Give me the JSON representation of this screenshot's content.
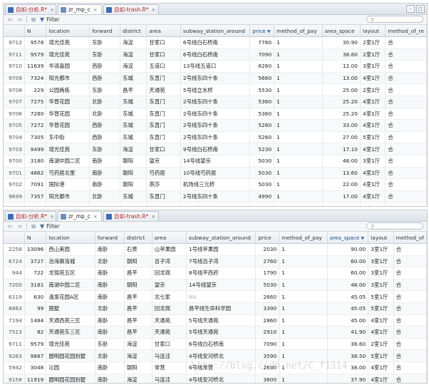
{
  "panels": [
    {
      "tabs": [
        {
          "label": "自如-分析.R*",
          "modified": true
        },
        {
          "label": "zr_mp_c",
          "modified": false
        },
        {
          "label": "自如-trash.R*",
          "modified": true
        }
      ],
      "filter_label": "Filter",
      "columns": [
        "",
        "N",
        "location",
        "forward",
        "district",
        "area",
        "subway_station_around",
        "price",
        "method_of_pay",
        "area_space",
        "layout",
        "method_of_re"
      ],
      "sorted_column": "price",
      "rows": [
        [
          "9712",
          "9578",
          "增光佳苑",
          "东卧",
          "海淀",
          "甘家口",
          "6号线白石桥南",
          "7760",
          "1",
          "30.90",
          "2室1厅",
          "合"
        ],
        [
          "9711",
          "9579",
          "增光佳苑",
          "东卧",
          "海淀",
          "甘家口",
          "6号线白石桥南",
          "7090",
          "1",
          "38.60",
          "2室1厅",
          "合"
        ],
        [
          "9710",
          "11639",
          "华清嘉园",
          "西卧",
          "海淀",
          "五道口",
          "13号线五道口",
          "6260",
          "1",
          "12.00",
          "3室1厅",
          "合"
        ],
        [
          "9709",
          "7324",
          "阳光都市",
          "西卧",
          "东城",
          "东直门",
          "2号线东四十条",
          "5660",
          "1",
          "13.00",
          "4室1厅",
          "合"
        ],
        [
          "9708",
          "229",
          "公园两栋",
          "东卧",
          "昌平",
          "天通苑",
          "5号线立水桥",
          "5530",
          "1",
          "25.00",
          "2室2厅",
          "合"
        ],
        [
          "9707",
          "7275",
          "华普花园",
          "北卧",
          "东城",
          "东直门",
          "2号线东四十条",
          "5360",
          "1",
          "25.20",
          "4室1厅",
          "合"
        ],
        [
          "9706",
          "7280",
          "华普花园",
          "北卧",
          "东城",
          "东直门",
          "2号线东四十条",
          "5360",
          "1",
          "25.20",
          "4室1厅",
          "合"
        ],
        [
          "9705",
          "7272",
          "华普花园",
          "西卧",
          "东城",
          "东直门",
          "2号线东四十条",
          "5260",
          "1",
          "33.00",
          "4室1厅",
          "合"
        ],
        [
          "9704",
          "7305",
          "东中街",
          "西卧",
          "东城",
          "东直门",
          "2号线东四十条",
          "5260",
          "1",
          "27.00",
          "5室1厅",
          "合"
        ],
        [
          "9703",
          "9499",
          "增光佳苑",
          "东卧",
          "海淀",
          "甘家口",
          "9号线白石桥南",
          "5230",
          "1",
          "17.10",
          "4室1厅",
          "合"
        ],
        [
          "9700",
          "3180",
          "南湖中园二区",
          "南卧",
          "朝阳",
          "望京",
          "14号线望京",
          "5030",
          "1",
          "48.00",
          "3室1厅",
          "合"
        ],
        [
          "9701",
          "4662",
          "芍药居北里",
          "南卧",
          "朝阳",
          "芍药居",
          "10号线芍药居",
          "5030",
          "1",
          "13.60",
          "4室2厅",
          "合"
        ],
        [
          "9702",
          "7091",
          "国际港",
          "南卧",
          "朝阳",
          "燕莎",
          "机场线三元桥",
          "5030",
          "1",
          "22.00",
          "4室1厅",
          "合"
        ],
        [
          "9699",
          "7357",
          "阳光都市",
          "北卧",
          "东城",
          "东直门",
          "2号线东四十条",
          "4990",
          "1",
          "17.00",
          "4室1厅",
          "合"
        ],
        [
          "9698",
          "5568",
          "朝庭公寓",
          "东卧",
          "朝阳",
          "望京",
          "14号线望京南",
          "4930",
          "1",
          "13.80",
          "3室1厅",
          "合"
        ]
      ]
    },
    {
      "tabs": [
        {
          "label": "自如-分析.R*",
          "modified": true
        },
        {
          "label": "zr_mp_c",
          "modified": false
        },
        {
          "label": "自如-trash.R*",
          "modified": true
        }
      ],
      "filter_label": "Filter",
      "columns": [
        "",
        "N",
        "location",
        "forward",
        "district",
        "area",
        "subway_station_around",
        "price",
        "method_of_pay",
        "area_space",
        "layout",
        "method_of"
      ],
      "sorted_column": "area_space",
      "rows": [
        [
          "2258",
          "13096",
          "西山美园",
          "南卧",
          "石景",
          "山苹果园",
          "1号线苹果园",
          "2030",
          "1",
          "90.00",
          "3室1厅",
          "合"
        ],
        [
          "6724",
          "3727",
          "治海赛洛城",
          "北卧",
          "朝阳",
          "百子湾",
          "7号线百子湾",
          "2760",
          "1",
          "60.00",
          "3室1厅",
          "合"
        ],
        [
          "944",
          "722",
          "龙锦苑五区",
          "南卧",
          "昌平",
          "回龙观",
          "8号线平西府",
          "1790",
          "1",
          "60.00",
          "3室1厅",
          "合"
        ],
        [
          "7200",
          "3181",
          "南湖中园二区",
          "南卧",
          "朝阳",
          "望京",
          "14号线望京",
          "5030",
          "1",
          "48.00",
          "3室1厅",
          "合"
        ],
        [
          "6119",
          "630",
          "温泉花园A区",
          "南卧",
          "昌平",
          "北七家",
          "NA",
          "2660",
          "1",
          "45.05",
          "5室1厅",
          "合"
        ],
        [
          "8863",
          "99",
          "国墅",
          "北卧",
          "昌平",
          "回龙观",
          "昌平线生命科学园",
          "3390",
          "1",
          "45.05",
          "5室1厅",
          "合"
        ],
        [
          "7194",
          "1484",
          "天通西苑三区",
          "南卧",
          "昌平",
          "天通苑",
          "5号线天通苑",
          "2860",
          "1",
          "45.00",
          "4室1厅",
          "合"
        ],
        [
          "7513",
          "82",
          "天通苑东三区",
          "南卧",
          "昌平",
          "天通苑",
          "5号线天通苑",
          "2910",
          "1",
          "41.90",
          "4室1厅",
          "合"
        ],
        [
          "9711",
          "9579",
          "增光佳苑",
          "东卧",
          "海淀",
          "甘家口",
          "6号线白石桥南",
          "7090",
          "1",
          "38.60",
          "2室1厅",
          "合"
        ],
        [
          "9263",
          "9887",
          "圆明园花园别墅",
          "北卧",
          "海淀",
          "马连洼",
          "4号线安河桥北",
          "3590",
          "1",
          "38.50",
          "5室1厅",
          "合"
        ],
        [
          "5942",
          "3048",
          "沁园",
          "南卧",
          "朝阳",
          "常营",
          "6号线常营",
          "2630",
          "1",
          "38.00",
          "4室1厅",
          "合"
        ],
        [
          "9158",
          "11919",
          "圆明园花园别墅",
          "南卧",
          "海淀",
          "马连洼",
          "4号线安河桥北",
          "3600",
          "1",
          "37.90",
          "4室1厅",
          "合"
        ]
      ]
    }
  ],
  "watermark": "http://blog.csdn.net/C_f1314"
}
